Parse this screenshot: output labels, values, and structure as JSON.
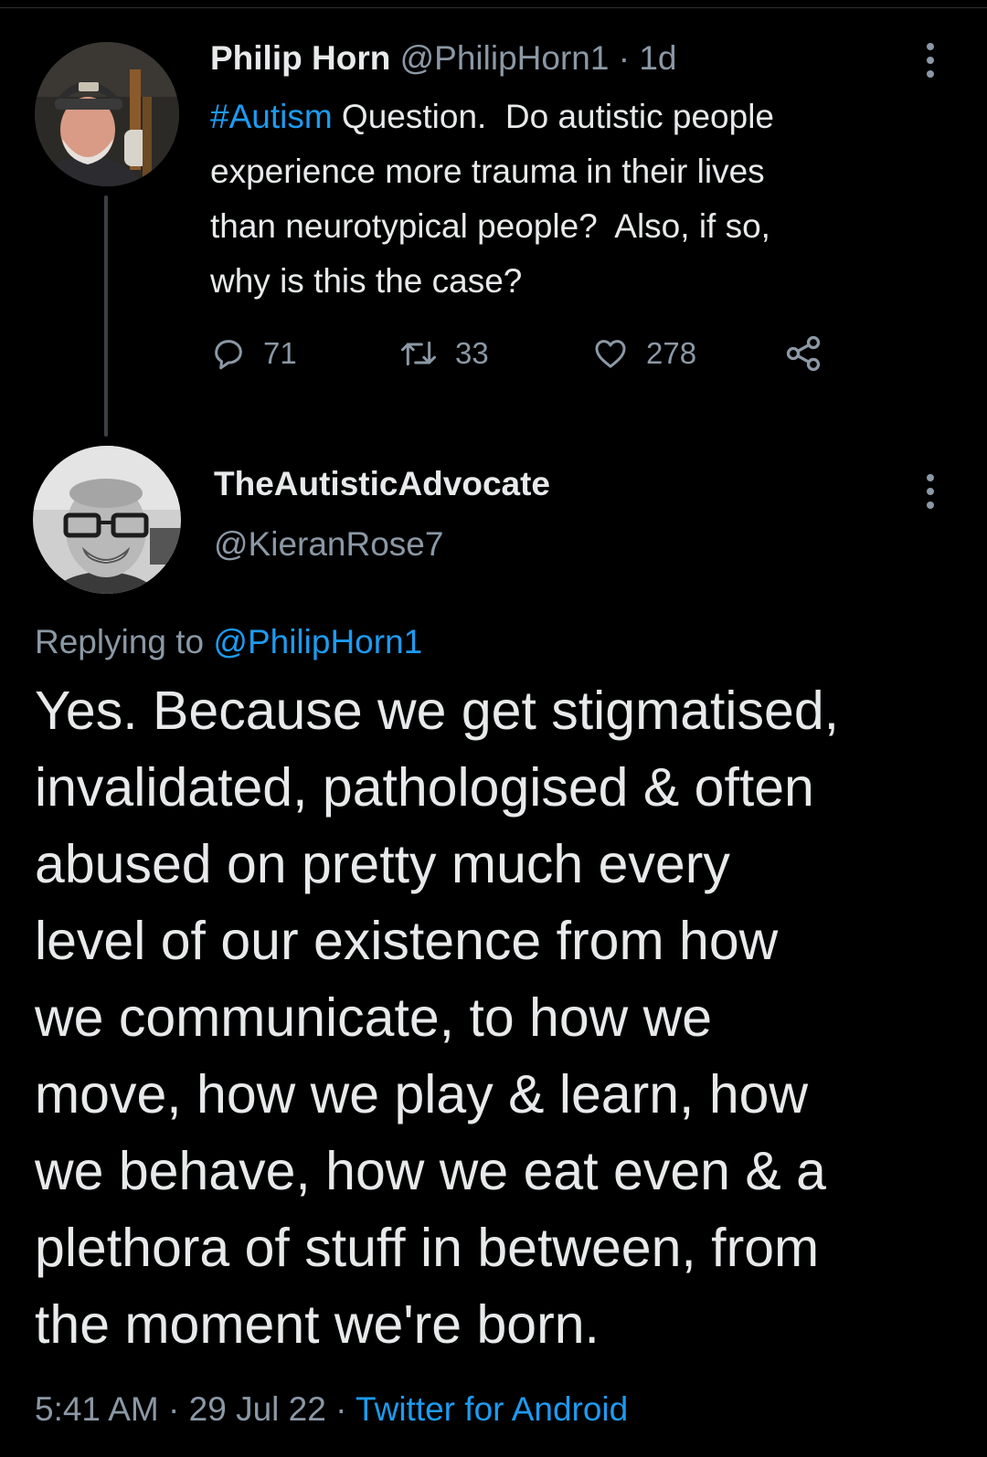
{
  "parent_tweet": {
    "author_name": "Philip Horn",
    "author_handle": "@PhilipHorn1",
    "separator": " · ",
    "time": "1d",
    "hashtag": "#Autism",
    "text": " Question.  Do autistic people experience more trauma in their lives than neurotypical people?  Also, if so, why is this the case?",
    "text_lines": [
      " Question.  Do autistic people",
      "experience more trauma in their lives",
      "than neurotypical people?  Also, if so,",
      "why is this the case?"
    ],
    "replies_count": "71",
    "retweets_count": "33",
    "likes_count": "278",
    "icons": {
      "reply": "reply-icon",
      "retweet": "retweet-icon",
      "like": "like-icon",
      "share": "share-icon",
      "more": "more-icon"
    }
  },
  "reply_tweet": {
    "author_name": "TheAutisticAdvocate",
    "author_handle": "@KieranRose7",
    "replying_prefix": "Replying to ",
    "replying_to": "@PhilipHorn1",
    "text_lines": [
      "Yes. Because we get stigmatised,",
      "invalidated, pathologised & often",
      "abused on pretty much every",
      "level of our existence from how",
      "we communicate, to how we",
      "move, how we play & learn, how",
      "we behave, how we eat even & a",
      "plethora of stuff in between, from",
      "the moment we're born."
    ],
    "time": "5:41 AM",
    "sep1": " · ",
    "date": "29 Jul 22",
    "sep2": " · ",
    "source": "Twitter for Android"
  },
  "colors": {
    "background": "#000000",
    "text": "#e7e9ea",
    "muted": "#8b98a5",
    "accent": "#1d9bf0",
    "thread_line": "#3b3f43"
  }
}
